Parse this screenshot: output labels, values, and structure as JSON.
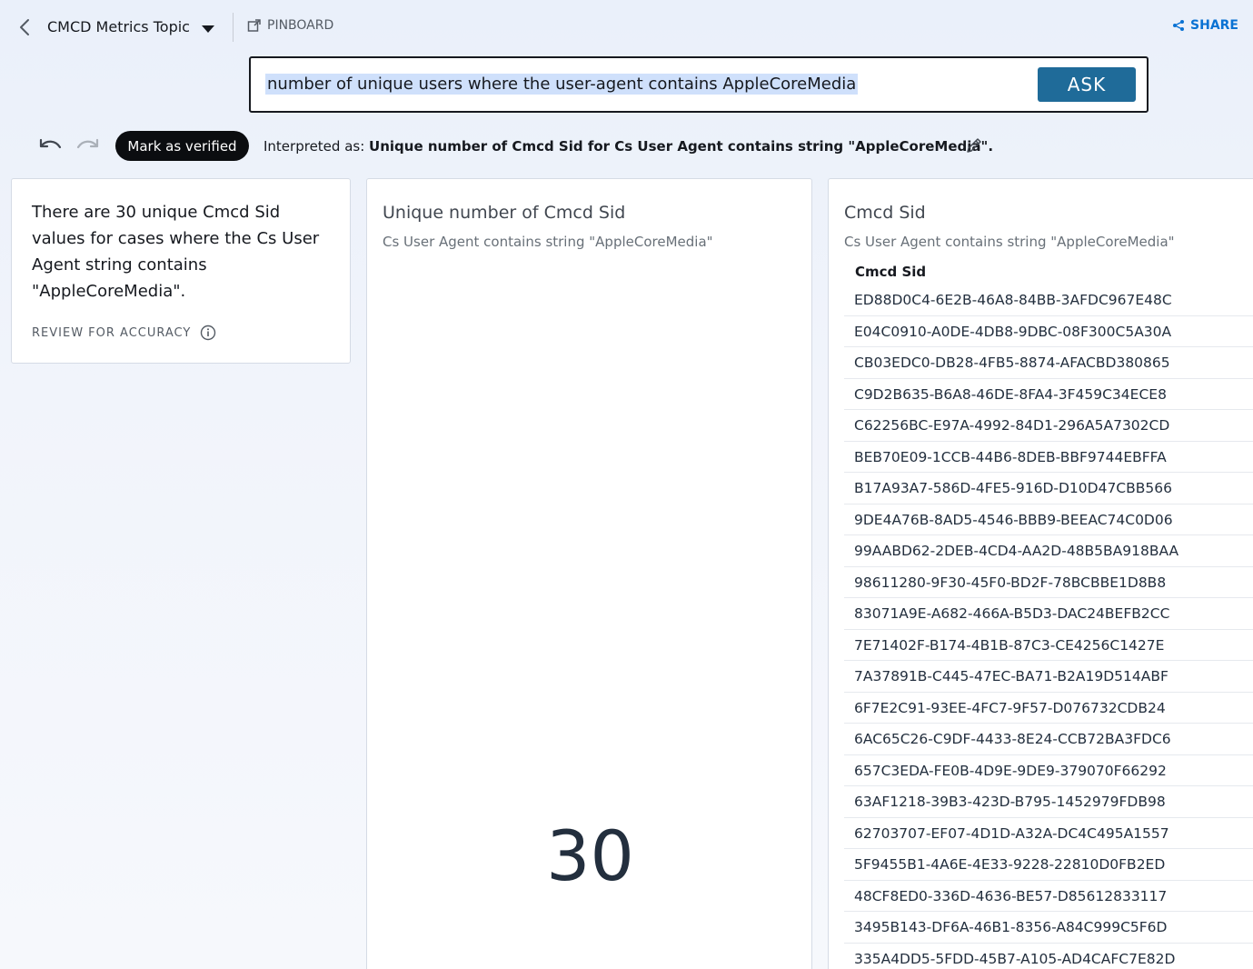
{
  "header": {
    "topic_title": "CMCD Metrics Topic",
    "pinboard_label": "PINBOARD",
    "share_label": "SHARE"
  },
  "search": {
    "query": "number of unique users where the user-agent contains AppleCoreMedia",
    "ask_label": "ASK"
  },
  "toolbar": {
    "verify_label": "Mark as verified",
    "interpreted_prefix": "Interpreted as:",
    "interpreted_text": "Unique number of Cmcd Sid for Cs User Agent contains string \"AppleCoreMedia\"."
  },
  "summary_card": {
    "text": "There are 30 unique Cmcd Sid values for cases where the Cs User Agent string contains \"AppleCoreMedia\".",
    "review_label": "REVIEW FOR ACCURACY"
  },
  "kpi_card": {
    "title": "Unique number of Cmcd Sid",
    "subtitle": "Cs User Agent contains string \"AppleCoreMedia\"",
    "value": "30"
  },
  "table_card": {
    "title": "Cmcd Sid",
    "subtitle": "Cs User Agent contains string \"AppleCoreMedia\"",
    "column_header": "Cmcd Sid",
    "rows": [
      "ED88D0C4-6E2B-46A8-84BB-3AFDC967E48C",
      "E04C0910-A0DE-4DB8-9DBC-08F300C5A30A",
      "CB03EDC0-DB28-4FB5-8874-AFACBD380865",
      "C9D2B635-B6A8-46DE-8FA4-3F459C34ECE8",
      "C62256BC-E97A-4992-84D1-296A5A7302CD",
      "BEB70E09-1CCB-44B6-8DEB-BBF9744EBFFA",
      "B17A93A7-586D-4FE5-916D-D10D47CBB566",
      "9DE4A76B-8AD5-4546-BBB9-BEEAC74C0D06",
      "99AABD62-2DEB-4CD4-AA2D-48B5BA918BAA",
      "98611280-9F30-45F0-BD2F-78BCBBE1D8B8",
      "83071A9E-A682-466A-B5D3-DAC24BEFB2CC",
      "7E71402F-B174-4B1B-87C3-CE4256C1427E",
      "7A37891B-C445-47EC-BA71-B2A19D514ABF",
      "6F7E2C91-93EE-4FC7-9F57-D076732CDB24",
      "6AC65C26-C9DF-4433-8E24-CCB72BA3FDC6",
      "657C3EDA-FE0B-4D9E-9DE9-379070F66292",
      "63AF1218-39B3-423D-B795-1452979FDB98",
      "62703707-EF07-4D1D-A32A-DC4C495A1557",
      "5F9455B1-4A6E-4E33-9228-22810D0FB2ED",
      "48CF8ED0-336D-4636-BE57-D85612833117",
      "3495B143-DF6A-46B1-8356-A84C999C5F6D",
      "335A4DD5-5FDD-45B7-A105-AD4CAFC7E82D"
    ]
  },
  "icons": {
    "back": "chevron-left-icon",
    "caret": "caret-down-icon",
    "pinboard": "pinboard-icon",
    "share": "share-icon",
    "undo": "undo-icon",
    "redo": "redo-icon",
    "edit": "pencil-icon",
    "info": "info-icon"
  },
  "colors": {
    "ask_button": "#1f6b99",
    "share_link": "#0972d3",
    "verify_button": "#0b0d10",
    "query_highlight": "#cfe0fb"
  }
}
